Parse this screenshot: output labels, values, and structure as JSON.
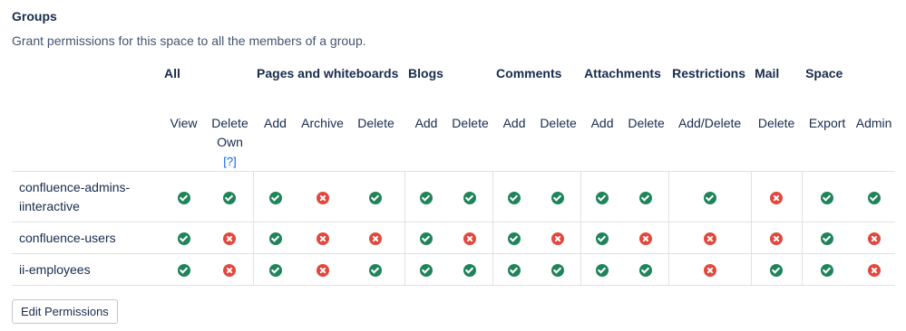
{
  "section": {
    "title": "Groups",
    "description": "Grant permissions for this space to all the members of a group."
  },
  "categories": {
    "all": "All",
    "pages": "Pages and whiteboards",
    "blogs": "Blogs",
    "comments": "Comments",
    "attachments": "Attachments",
    "restrictions": "Restrictions",
    "mail": "Mail",
    "space": "Space"
  },
  "columns": {
    "view": "View",
    "delete_own": "Delete Own",
    "delete_own_help": "[?]",
    "pages_add": "Add",
    "pages_archive": "Archive",
    "pages_delete": "Delete",
    "blogs_add": "Add",
    "blogs_delete": "Delete",
    "comments_add": "Add",
    "comments_delete": "Delete",
    "attachments_add": "Add",
    "attachments_delete": "Delete",
    "restrictions_add_delete": "Add/Delete",
    "mail_delete": "Delete",
    "space_export": "Export",
    "space_admin": "Admin"
  },
  "groups": [
    {
      "name": "confluence-admins-iinteractive",
      "permissions": [
        true,
        true,
        true,
        false,
        true,
        true,
        true,
        true,
        true,
        true,
        true,
        true,
        false,
        true,
        true
      ]
    },
    {
      "name": "confluence-users",
      "permissions": [
        true,
        false,
        true,
        false,
        false,
        true,
        false,
        true,
        false,
        true,
        false,
        false,
        false,
        true,
        false
      ]
    },
    {
      "name": "ii-employees",
      "permissions": [
        true,
        false,
        true,
        false,
        true,
        true,
        true,
        true,
        true,
        true,
        true,
        false,
        true,
        true,
        false
      ]
    }
  ],
  "status_colors": {
    "granted": "#1f845a",
    "denied": "#e2483d"
  },
  "actions": {
    "edit_permissions": "Edit Permissions"
  }
}
